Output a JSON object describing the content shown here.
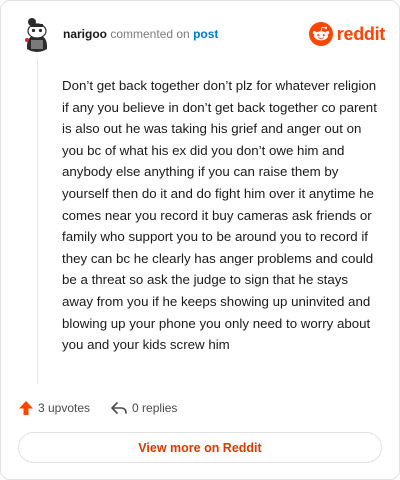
{
  "comment": {
    "username": "narigoo",
    "action_text": "commented on",
    "post_link": "post",
    "body": "Don’t get back together don’t plz for whatever religion if any you believe in don’t get back together co parent is also out he was taking his grief and anger out on you bc of what his ex did you don’t owe him and anybody else anything if you can raise them by yourself then do it and do fight him over it anytime he comes near you record it buy cameras ask friends or family who support you to be around you to record if they can bc he clearly has anger problems and could be a threat so ask the judge to sign that he stays away from you if he keeps showing up uninvited and blowing up your phone you only need to worry about you and your kids screw him"
  },
  "brand": {
    "wordmark": "reddit",
    "color": "#ff4500"
  },
  "actions": {
    "upvotes_label": "3 upvotes",
    "replies_label": "0 replies"
  },
  "footer": {
    "view_more_label": "View more on Reddit"
  },
  "icons": {
    "avatar": "snoo-avatar",
    "logo": "reddit-snoo-icon",
    "upvote": "upvote-arrow-icon",
    "reply": "reply-arrow-icon"
  },
  "colors": {
    "upvote": "#ff4500",
    "link": "#0079d3",
    "cta": "#d93a00"
  }
}
